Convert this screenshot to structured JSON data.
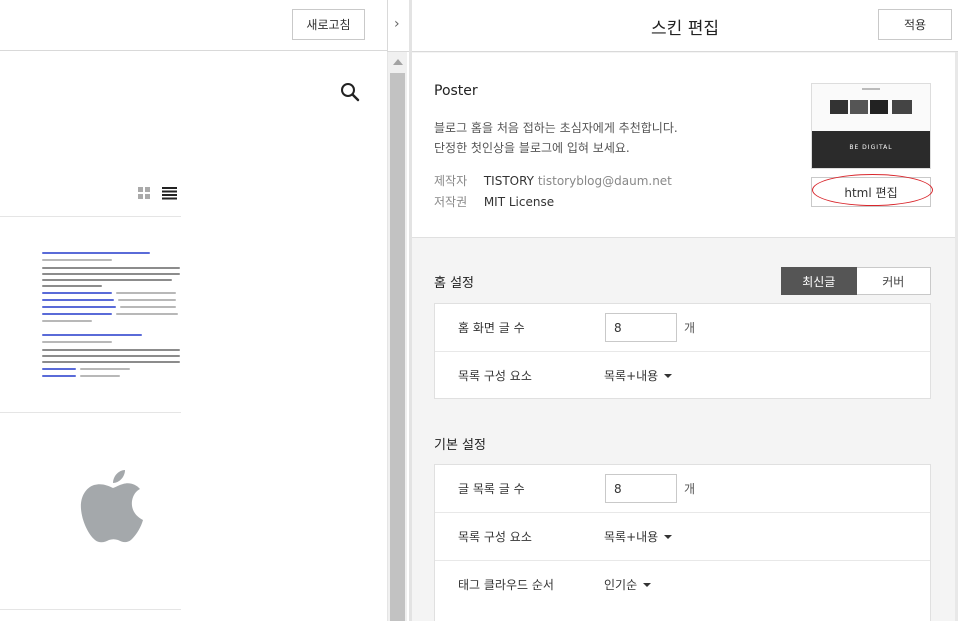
{
  "left_pane": {
    "refresh_label": "새로고침",
    "collapse_arrow": "›",
    "icons": [
      "search-icon",
      "grid-view-icon",
      "list-view-icon",
      "apple-logo-icon"
    ]
  },
  "right_pane": {
    "title": "스킨 편집",
    "apply_label": "적용",
    "skin": {
      "name": "Poster",
      "description": "블로그 홈을 처음 접하는 초심자에게 추천합니다.\n단정한 첫인상을 블로그에 입혀 보세요.",
      "maker_label": "제작자",
      "maker_value": "TISTORY",
      "maker_email": "tistoryblog@daum.net",
      "license_label": "저작권",
      "license_value": "MIT License",
      "thumbnail_text": "BE DIGITAL",
      "html_edit_label": "html 편집"
    },
    "home_settings": {
      "title": "홈 설정",
      "tabs": [
        "최신글",
        "커버"
      ],
      "selected_tab": "최신글",
      "rows": [
        {
          "label": "홈 화면 글 수",
          "value": "8",
          "unit": "개"
        },
        {
          "label": "목록 구성 요소",
          "value": "목록+내용"
        }
      ]
    },
    "basic_settings": {
      "title": "기본 설정",
      "rows": [
        {
          "label": "글 목록 글 수",
          "value": "8",
          "unit": "개"
        },
        {
          "label": "목록 구성 요소",
          "value": "목록+내용"
        },
        {
          "label": "태그 클라우드 순서",
          "value": "인기순"
        }
      ]
    }
  },
  "colors": {
    "accent_ring": "#d9262c",
    "segment_active": "#555555",
    "panel_background": "#f4f4f4"
  }
}
